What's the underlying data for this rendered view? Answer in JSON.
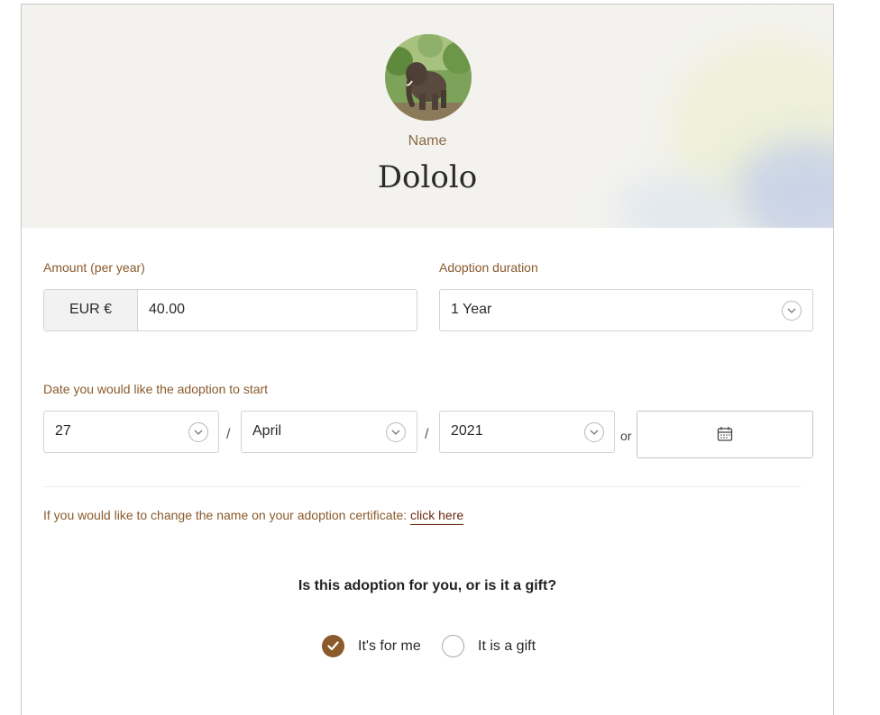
{
  "hero": {
    "photo_alt": "Elephant photo",
    "name_label": "Name",
    "name_value": "Dololo"
  },
  "amount": {
    "label": "Amount (per year)",
    "currency": "EUR €",
    "value": "40.00"
  },
  "duration": {
    "label": "Adoption duration",
    "selected": "1 Year"
  },
  "start_date": {
    "label": "Date you would like the adoption to start",
    "day": "27",
    "month": "April",
    "year": "2021",
    "separator": "/",
    "or": "or"
  },
  "certificate": {
    "text": "If you would like to change the name on your adoption certificate:",
    "link": "click here"
  },
  "gift": {
    "question": "Is this adoption for you, or is it a gift?",
    "options": [
      "It's for me",
      "It is a gift"
    ],
    "selected_index": 0
  },
  "colors": {
    "accent": "#8a5a2b",
    "radio_checked": "#8b5a2b",
    "link": "#6b2a12"
  }
}
